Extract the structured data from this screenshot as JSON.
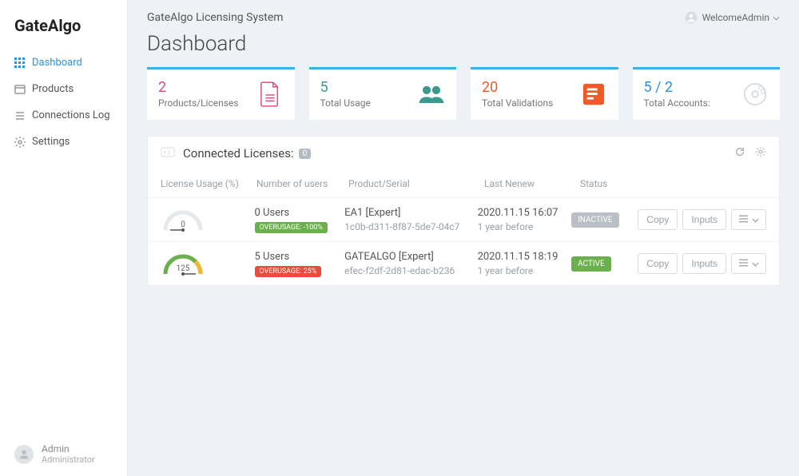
{
  "brand": "GateAlgo",
  "system_title": "GateAlgo Licensing System",
  "welcome_prefix": "Welcome ",
  "welcome_user": "Admin",
  "page_title": "Dashboard",
  "nav": {
    "dashboard": "Dashboard",
    "products": "Products",
    "connections": "Connections Log",
    "settings": "Settings"
  },
  "footer_user": {
    "name": "Admin",
    "role": "Administrator"
  },
  "cards": {
    "c1": {
      "value": "2",
      "label": "Products/Licenses",
      "color": "#e64980"
    },
    "c2": {
      "value": "5",
      "label": "Total Usage",
      "color": "#3a9a8f"
    },
    "c3": {
      "value": "20",
      "label": "Total Validations",
      "color": "#f05a28"
    },
    "c4": {
      "value": "5 / 2",
      "label": "Total Accounts:",
      "color": "#2b92e4"
    }
  },
  "panel": {
    "title": "Connected Licenses:",
    "badge": "0",
    "columns": {
      "usage": "License Usage (%)",
      "users": "Number of users",
      "serial": "Product/Serial",
      "renew": "Last Nenew",
      "status": "Status"
    },
    "rows": [
      {
        "gauge": "0",
        "gauge_color": "#c8c8c8",
        "gauge_pct": 0,
        "users": "0 Users",
        "over_label": "OVERUSAGE: -100%",
        "over_class": "badge-green",
        "product": "EA1 [Expert]",
        "serial": "1c0b-d311-8f87-5de7-04c7",
        "renew": "2020.11.15 16:07",
        "renew_ago": "1 year before",
        "status": "INACTIVE",
        "status_class": "status-inactive",
        "btn1": "Copy",
        "btn2": "Inputs"
      },
      {
        "gauge": "125",
        "gauge_color": "#6ab04c",
        "gauge_pct": 100,
        "users": "5 Users",
        "over_label": "OVERUSAGE: 25%",
        "over_class": "badge-red",
        "product": "GATEALGO [Expert]",
        "serial": "efec-f2df-2d81-edac-b236",
        "renew": "2020.11.15 18:19",
        "renew_ago": "1 year before",
        "status": "ACTIVE",
        "status_class": "status-active",
        "btn1": "Copy",
        "btn2": "Inputs"
      }
    ]
  }
}
